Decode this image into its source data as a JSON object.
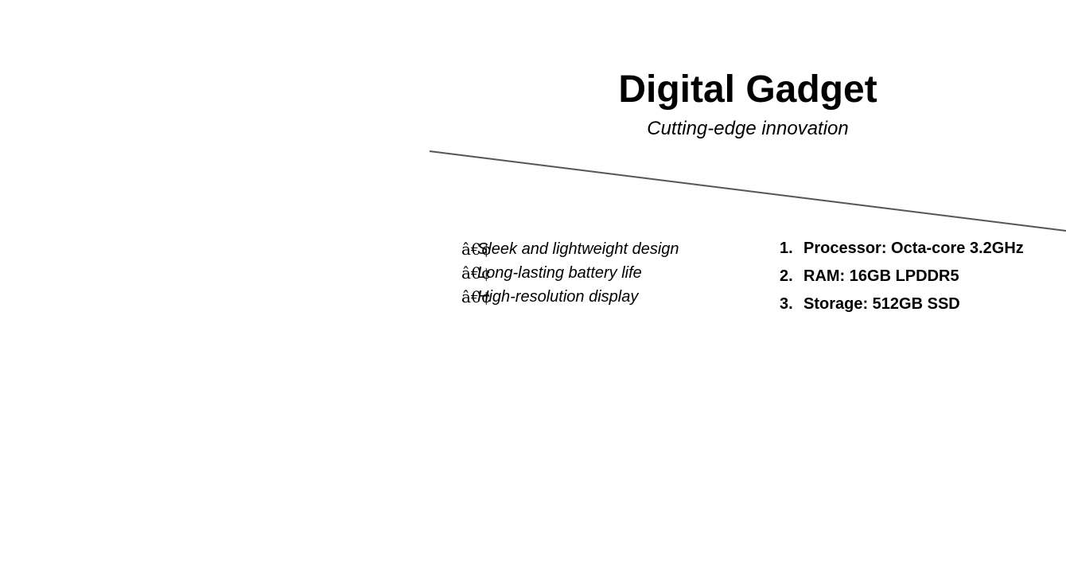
{
  "header": {
    "title": "Digital Gadget",
    "subtitle": "Cutting-edge innovation"
  },
  "features": {
    "bullet_glyph": "â€¢",
    "items": [
      "Sleek and lightweight design",
      "Long-lasting battery life",
      "High-resolution display"
    ]
  },
  "specs": {
    "items": [
      {
        "number": "1.",
        "text": "Processor: Octa-core 3.2GHz"
      },
      {
        "number": "2.",
        "text": "RAM: 16GB LPDDR5"
      },
      {
        "number": "3.",
        "text": "Storage: 512GB SSD"
      }
    ]
  },
  "colors": {
    "text": "#000000",
    "divider": "#555555",
    "background": "#ffffff"
  }
}
